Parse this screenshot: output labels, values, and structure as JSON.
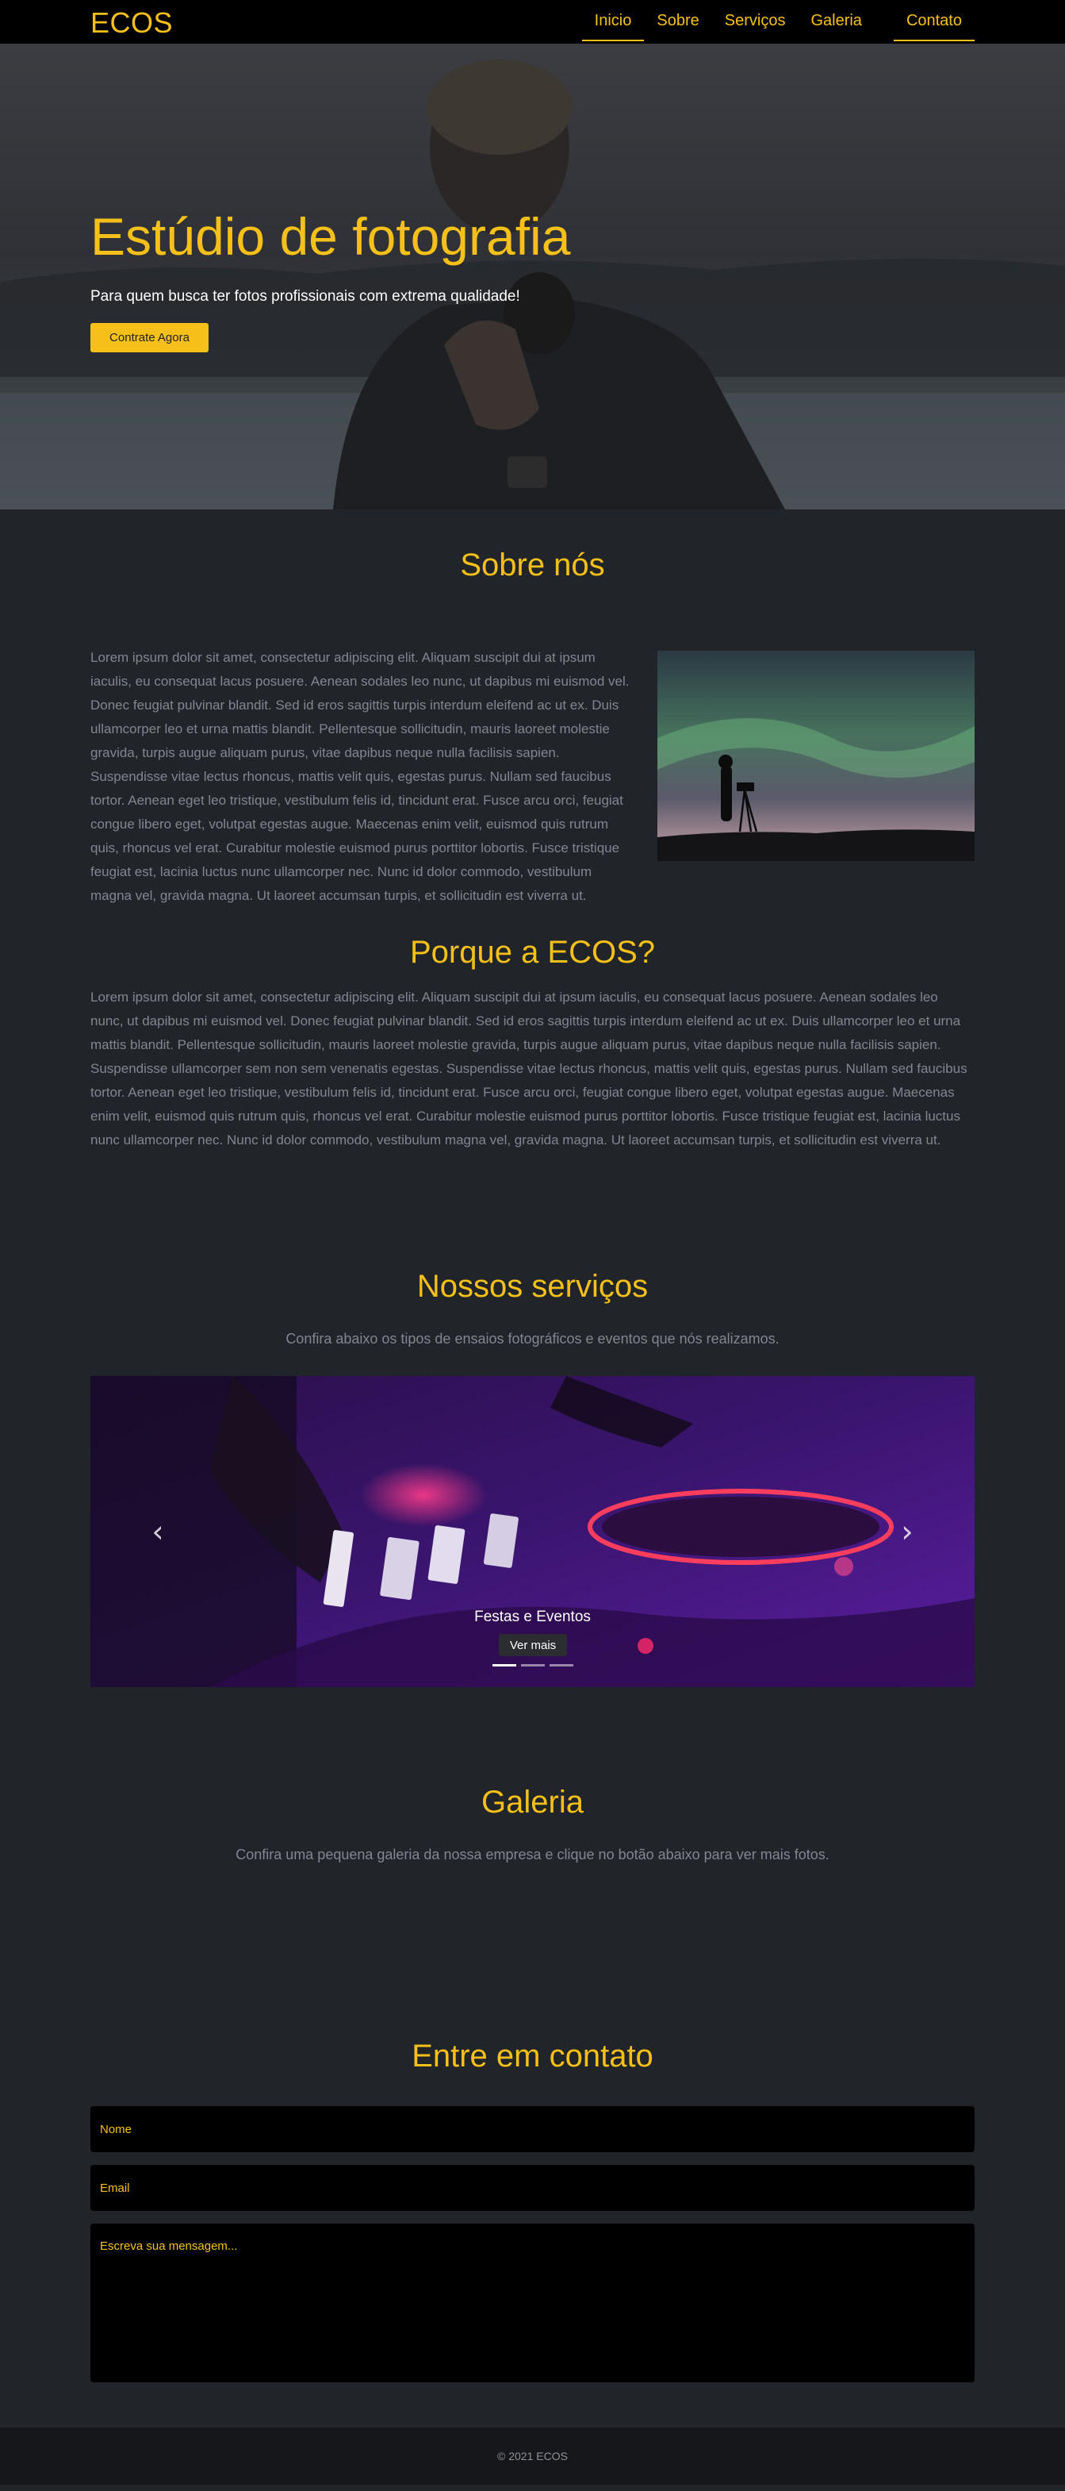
{
  "nav": {
    "brand": "ECOS",
    "items": [
      {
        "label": "Inicio"
      },
      {
        "label": "Sobre"
      },
      {
        "label": "Serviços"
      },
      {
        "label": "Galeria"
      },
      {
        "label": "Contato"
      }
    ]
  },
  "hero": {
    "title": "Estúdio de fotografia",
    "subtitle": "Para quem busca ter fotos profissionais com extrema qualidade!",
    "cta_label": "Contrate Agora"
  },
  "sobre": {
    "title": "Sobre nós",
    "text": "Lorem ipsum dolor sit amet, consectetur adipiscing elit. Aliquam suscipit dui at ipsum iaculis, eu consequat lacus posuere. Aenean sodales leo nunc, ut dapibus mi euismod vel. Donec feugiat pulvinar blandit. Sed id eros sagittis turpis interdum eleifend ac ut ex. Duis ullamcorper leo et urna mattis blandit. Pellentesque sollicitudin, mauris laoreet molestie gravida, turpis augue aliquam purus, vitae dapibus neque nulla facilisis sapien. Suspendisse vitae lectus rhoncus, mattis velit quis, egestas purus. Nullam sed faucibus tortor. Aenean eget leo tristique, vestibulum felis id, tincidunt erat. Fusce arcu orci, feugiat congue libero eget, volutpat egestas augue. Maecenas enim velit, euismod quis rutrum quis, rhoncus vel erat. Curabitur molestie euismod purus porttitor lobortis. Fusce tristique feugiat est, lacinia luctus nunc ullamcorper nec. Nunc id dolor commodo, vestibulum magna vel, gravida magna. Ut laoreet accumsan turpis, et sollicitudin est viverra ut."
  },
  "porque": {
    "title": "Porque a ECOS?",
    "text": "Lorem ipsum dolor sit amet, consectetur adipiscing elit. Aliquam suscipit dui at ipsum iaculis, eu consequat lacus posuere. Aenean sodales leo nunc, ut dapibus mi euismod vel. Donec feugiat pulvinar blandit. Sed id eros sagittis turpis interdum eleifend ac ut ex. Duis ullamcorper leo et urna mattis blandit. Pellentesque sollicitudin, mauris laoreet molestie gravida, turpis augue aliquam purus, vitae dapibus neque nulla facilisis sapien. Suspendisse ullamcorper sem non sem venenatis egestas. Suspendisse vitae lectus rhoncus, mattis velit quis, egestas purus. Nullam sed faucibus tortor. Aenean eget leo tristique, vestibulum felis id, tincidunt erat. Fusce arcu orci, feugiat congue libero eget, volutpat egestas augue. Maecenas enim velit, euismod quis rutrum quis, rhoncus vel erat. Curabitur molestie euismod purus porttitor lobortis. Fusce tristique feugiat est, lacinia luctus nunc ullamcorper nec. Nunc id dolor commodo, vestibulum magna vel, gravida magna. Ut laoreet accumsan turpis, et sollicitudin est viverra ut."
  },
  "servicos": {
    "title": "Nossos serviços",
    "subtitle": "Confira abaixo os tipos de ensaios fotográficos e eventos que nós realizamos.",
    "slide_caption": "Festas e Eventos",
    "slide_button": "Ver mais",
    "prev_icon": "‹",
    "next_icon": "›",
    "slide_count": 3,
    "active_slide": 1
  },
  "galeria": {
    "title": "Galeria",
    "subtitle": "Confira uma pequena galeria da nossa empresa e clique no botão abaixo para ver mais fotos."
  },
  "contato": {
    "title": "Entre em contato",
    "name_placeholder": "Nome",
    "email_placeholder": "Email",
    "message_placeholder": "Escreva sua mensagem..."
  },
  "footer": {
    "text": "© 2021 ECOS"
  },
  "colors": {
    "accent": "#f5c01a",
    "background": "#212429",
    "navbar": "#000000",
    "footer": "#15171a"
  }
}
